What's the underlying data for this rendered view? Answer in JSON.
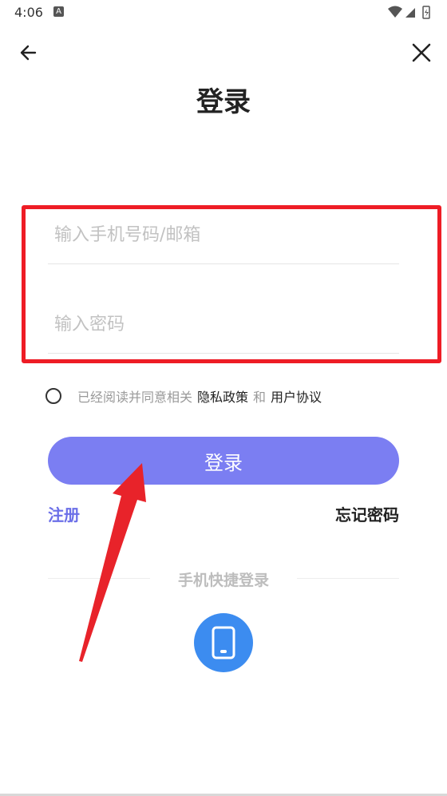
{
  "status_bar": {
    "time": "4:06",
    "notification_icon": "A"
  },
  "nav": {
    "back_icon": "arrow-left",
    "close_icon": "close-x"
  },
  "page": {
    "title": "登录"
  },
  "form": {
    "account_placeholder": "输入手机号码/邮箱",
    "account_value": "",
    "password_placeholder": "输入密码",
    "password_value": ""
  },
  "agreement": {
    "checked": false,
    "prefix": "已经阅读并同意相关",
    "privacy_link": "隐私政策",
    "and": "和",
    "terms_link": "用户协议"
  },
  "actions": {
    "login_label": "登录",
    "register_label": "注册",
    "forgot_label": "忘记密码"
  },
  "quick_login": {
    "label": "手机快捷登录",
    "icon": "phone-icon"
  },
  "colors": {
    "accent": "#7b7ef2",
    "register": "#6b6fe8",
    "highlight_box": "#ee1c25",
    "quick_login_bg": "#3c8cf0",
    "annotation_arrow": "#e8232a"
  }
}
